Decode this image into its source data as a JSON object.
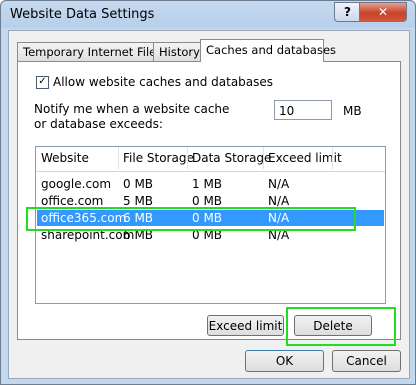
{
  "window": {
    "title": "Website Data Settings",
    "help": "?",
    "close": "✕"
  },
  "tabs": [
    "Temporary Internet Files",
    "History",
    "Caches and databases"
  ],
  "allow": {
    "checked": "✓",
    "label": "Allow website caches and databases"
  },
  "notify": {
    "label": "Notify me when a website cache or database exceeds:",
    "value": "10",
    "unit": "MB"
  },
  "table": {
    "headers": [
      "Website",
      "File Storage",
      "Data Storage",
      "Exceed limit"
    ],
    "rows": [
      [
        "google.com",
        "0 MB",
        "1 MB",
        "N/A"
      ],
      [
        "office.com",
        "5 MB",
        "0 MB",
        "N/A"
      ],
      [
        "office365.com",
        "6 MB",
        "0 MB",
        "N/A"
      ],
      [
        "sharepoint.com",
        "6 MB",
        "0 MB",
        "N/A"
      ]
    ],
    "selected_row": 2
  },
  "buttons": {
    "exceed": "Exceed limit",
    "delete": "Delete",
    "ok": "OK",
    "cancel": "Cancel"
  }
}
